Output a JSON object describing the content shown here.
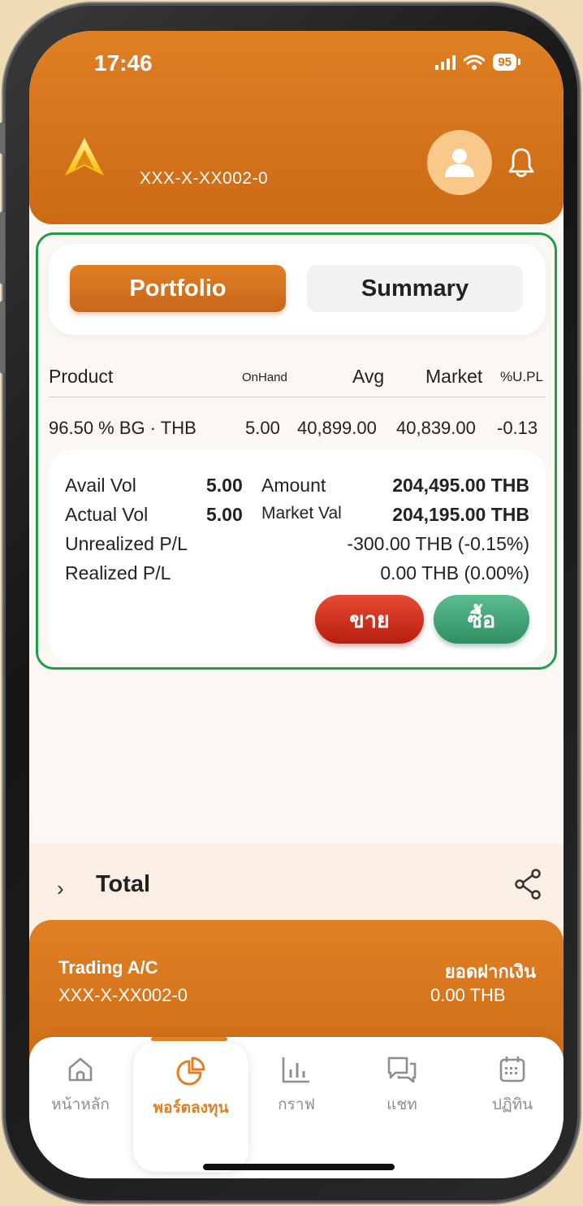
{
  "status_bar": {
    "time": "17:46",
    "battery": "95"
  },
  "header": {
    "account_number": "XXX-X-XX002-0"
  },
  "tabs": [
    {
      "label": "Portfolio",
      "active": true
    },
    {
      "label": "Summary",
      "active": false
    }
  ],
  "table": {
    "columns": [
      "Product",
      "OnHand",
      "Avg",
      "Market",
      "%U.PL"
    ],
    "rows": [
      {
        "product": "96.50 % BG · THB",
        "onhand": "5.00",
        "avg": "40,899.00",
        "market": "40,839.00",
        "upl": "-0.13"
      }
    ]
  },
  "detail": {
    "avail_vol_label": "Avail Vol",
    "avail_vol": "5.00",
    "amount_label": "Amount",
    "amount": "204,495.00 THB",
    "actual_vol_label": "Actual Vol",
    "actual_vol": "5.00",
    "market_val_label": "Market Val",
    "market_val": "204,195.00 THB",
    "unrealized_label": "Unrealized P/L",
    "unrealized": "-300.00 THB (-0.15%)",
    "realized_label": "Realized P/L",
    "realized": "0.00 THB (0.00%)",
    "sell_label": "ขาย",
    "buy_label": "ซื้อ"
  },
  "total": {
    "label": "Total"
  },
  "trading_account": {
    "title": "Trading A/C",
    "number": "XXX-X-XX002-0",
    "deposit_label": "ยอดฝากเงิน",
    "deposit_value": "0.00 THB"
  },
  "nav": [
    {
      "label": "หน้าหลัก",
      "icon": "home-icon",
      "active": false
    },
    {
      "label": "พอร์ตลงทุน",
      "icon": "pie-chart-icon",
      "active": true
    },
    {
      "label": "กราฟ",
      "icon": "bar-chart-icon",
      "active": false
    },
    {
      "label": "แชท",
      "icon": "chat-icon",
      "active": false
    },
    {
      "label": "ปฏิทิน",
      "icon": "calendar-icon",
      "active": false
    }
  ],
  "colors": {
    "brand": "#e07f23",
    "sell": "#d63a25",
    "buy": "#3f9f72",
    "highlight": "#1f9d4a"
  }
}
